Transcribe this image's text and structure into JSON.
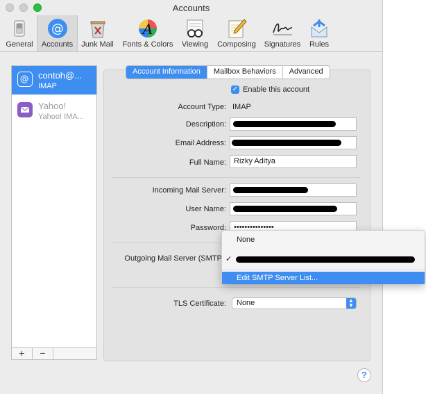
{
  "window": {
    "title": "Accounts"
  },
  "toolbar": {
    "items": [
      {
        "label": "General",
        "icon": "switch-icon"
      },
      {
        "label": "Accounts",
        "icon": "at-icon"
      },
      {
        "label": "Junk Mail",
        "icon": "trash-icon"
      },
      {
        "label": "Fonts & Colors",
        "icon": "fonts-icon"
      },
      {
        "label": "Viewing",
        "icon": "glasses-icon"
      },
      {
        "label": "Composing",
        "icon": "pencil-icon"
      },
      {
        "label": "Signatures",
        "icon": "signature-icon"
      },
      {
        "label": "Rules",
        "icon": "rules-icon"
      }
    ]
  },
  "accounts": [
    {
      "name": "contoh@...",
      "type": "IMAP",
      "icon": "at-icon"
    },
    {
      "name": "Yahoo!",
      "type": "Yahoo! IMA...",
      "icon": "mail-icon"
    }
  ],
  "list_footer": {
    "add": "+",
    "remove": "−"
  },
  "tabs": [
    "Account Information",
    "Mailbox Behaviors",
    "Advanced"
  ],
  "form": {
    "enable_label": "Enable this account",
    "account_type_label": "Account Type:",
    "account_type_value": "IMAP",
    "description_label": "Description:",
    "email_label": "Email Address:",
    "fullname_label": "Full Name:",
    "fullname_value": "Rizky Aditya",
    "incoming_label": "Incoming Mail Server:",
    "username_label": "User Name:",
    "password_label": "Password:",
    "password_value": "•••••••••••••••",
    "outgoing_label": "Outgoing Mail Server (SMTP",
    "tls_label": "TLS Certificate:",
    "tls_value": "None"
  },
  "smtp_menu": {
    "none": "None",
    "check": "✓",
    "edit": "Edit SMTP Server List..."
  },
  "help": "?",
  "colors": {
    "accent": "#3d8ef0",
    "redacted": "#000000"
  }
}
